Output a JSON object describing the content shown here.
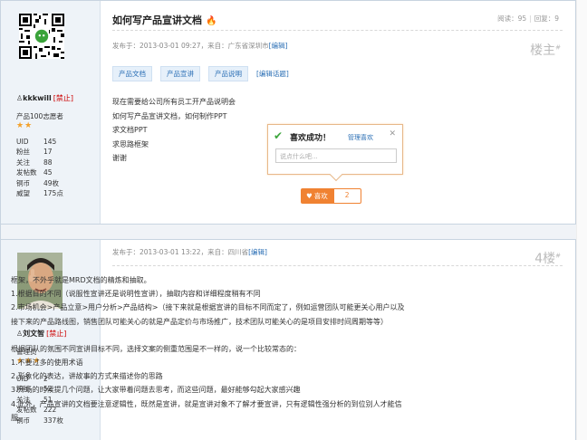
{
  "post1": {
    "title": "如何写产品宣讲文档",
    "counts": {
      "views_label": "阅读：",
      "views": "95",
      "replies_label": "回复：",
      "replies": "9"
    },
    "meta": "发布于：2013-03-01 09:27，来自：广东省深圳市",
    "edit_label": "[编辑]",
    "floor": "楼主",
    "tags": [
      "产品文档",
      "产品宣讲",
      "产品说明"
    ],
    "add_tag": "[编辑话题]",
    "body": [
      "现在需要给公司所有员工开产品说明会",
      "如何写产品宣讲文档，如何制作PPT",
      "求文档PPT",
      "求思路框架",
      "谢谢"
    ],
    "user": {
      "name": "kkkwill",
      "ban": "[禁止]",
      "rank": "产品100志愿者",
      "stars": "★★",
      "stats": [
        {
          "k": "UID",
          "v": "145"
        },
        {
          "k": "粉丝",
          "v": "17"
        },
        {
          "k": "关注",
          "v": "88"
        },
        {
          "k": "发帖数",
          "v": "45"
        },
        {
          "k": "铜币",
          "v": "49枚"
        },
        {
          "k": "威望",
          "v": "175点"
        }
      ]
    }
  },
  "popup": {
    "title": "喜欢成功！",
    "manage": "管理喜欢",
    "close": "✕",
    "placeholder": "说点什么吧..."
  },
  "like": {
    "label": "喜欢",
    "count": "2"
  },
  "post2": {
    "meta": "发布于：2013-03-01 13:22，来自：四川省",
    "edit_label": "[编辑]",
    "floor": "4楼",
    "body": [
      "框架，不外乎就是MRD文档的精炼和抽取。",
      "1.根据目的不同（说服性宣讲还是说明性宣讲），抽取内容和详细程度稍有不同",
      "2.市场机会>产品立意>用户分析>产品结构>（接下来就是根据宣讲的目标不同而定了，例如运营团队可能更关心用户以及",
      "接下来的产品路线图，销售团队可能关心的就是产品定价与市场推广，技术团队可能关心的是项目安排时间周期等等）",
      "",
      "根据团队的氛围不同宣讲目标不同，选择文案的侧重范围是不一样的，说一个比较常态的：",
      "1.不要过多的使用术语",
      "2.形象化的表达，讲故事的方式来描述你的思路",
      "3.开场的时候提几个问题，让大家带着问题去思考，而这些问题，最好能够勾起大家感兴趣",
      "4.此外，产品宣讲的文档要注意逻辑性，既然是宣讲，就是宣讲对象不了解才要宣讲，只有逻辑性强分析的到位别人才能信",
      "服。"
    ],
    "user": {
      "name": "刘文智",
      "ban": "[禁止]",
      "rank": "管理员",
      "stars": "★★★",
      "stats": [
        {
          "k": "UID",
          "v": "2"
        },
        {
          "k": "粉丝",
          "v": "52"
        },
        {
          "k": "关注",
          "v": "51"
        },
        {
          "k": "发帖数",
          "v": "222"
        },
        {
          "k": "铜币",
          "v": "337枚"
        }
      ]
    }
  }
}
